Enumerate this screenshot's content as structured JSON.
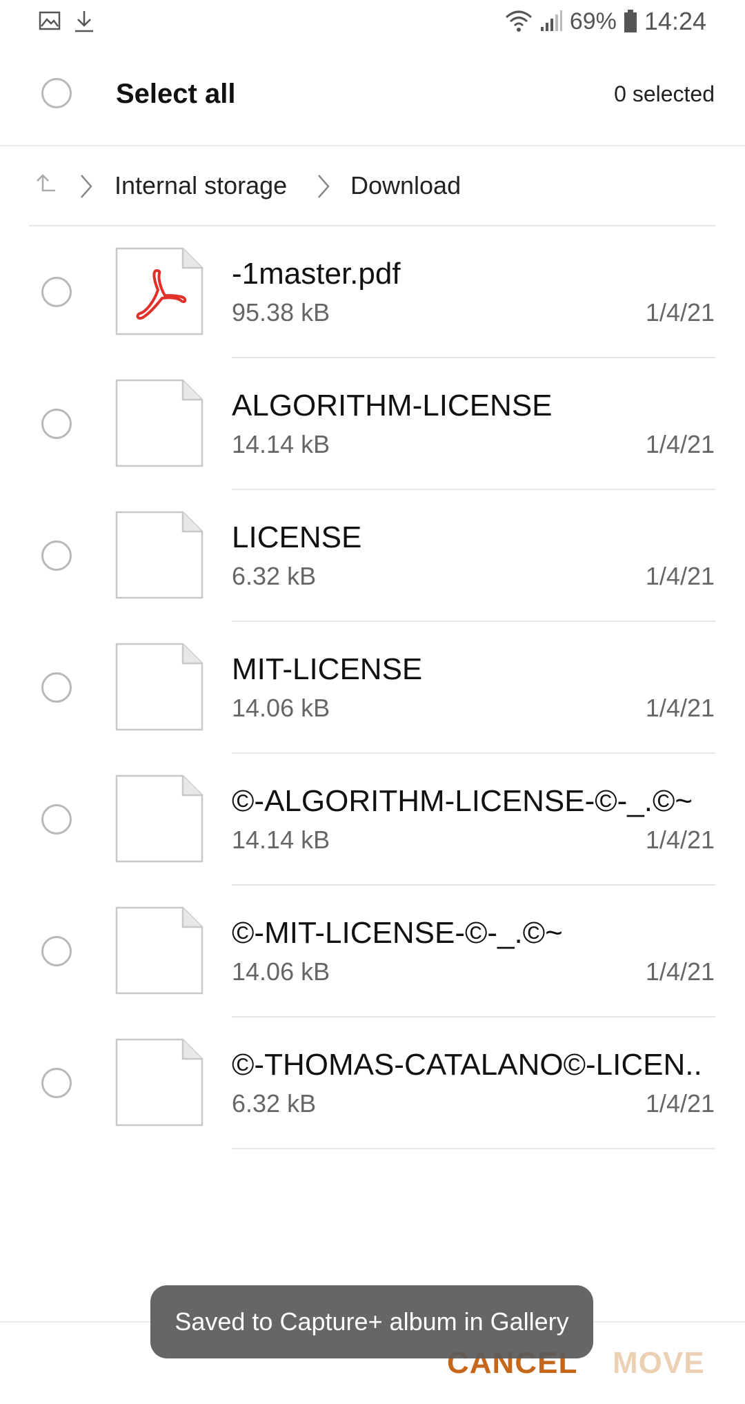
{
  "status_bar": {
    "left_icons": [
      "image-icon",
      "download-icon"
    ],
    "battery_percent": "69%",
    "time": "14:24"
  },
  "header": {
    "select_all_label": "Select all",
    "selected_count": "0 selected"
  },
  "breadcrumb": {
    "items": [
      "Internal storage",
      "Download"
    ]
  },
  "files": [
    {
      "name": "-1master.pdf",
      "size": "95.38 kB",
      "date": "1/4/21",
      "icon": "pdf-file-icon"
    },
    {
      "name": "ALGORITHM-LICENSE",
      "size": "14.14 kB",
      "date": "1/4/21",
      "icon": "generic-file-icon"
    },
    {
      "name": "LICENSE",
      "size": "6.32 kB",
      "date": "1/4/21",
      "icon": "generic-file-icon"
    },
    {
      "name": "MIT-LICENSE",
      "size": "14.06 kB",
      "date": "1/4/21",
      "icon": "generic-file-icon"
    },
    {
      "name": "©-ALGORITHM-LICENSE-©-_.©~",
      "size": "14.14 kB",
      "date": "1/4/21",
      "icon": "generic-file-icon"
    },
    {
      "name": "©-MIT-LICENSE-©-_.©~",
      "size": "14.06 kB",
      "date": "1/4/21",
      "icon": "generic-file-icon"
    },
    {
      "name": "©-THOMAS-CATALANO©-LICEN..",
      "size": "6.32 kB",
      "date": "1/4/21",
      "icon": "generic-file-icon"
    }
  ],
  "actions": {
    "cancel_label": "CANCEL",
    "move_label": "MOVE"
  },
  "toast": {
    "message": "Saved to Capture+ album in Gallery"
  },
  "colors": {
    "accent": "#c4671b",
    "accent_disabled": "#ecd0b4",
    "pdf_red": "#e0302a"
  }
}
